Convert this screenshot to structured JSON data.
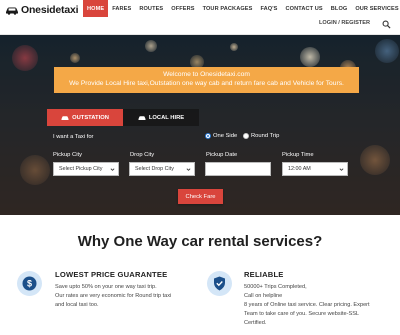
{
  "brand": {
    "name": "Onesidetaxi"
  },
  "nav": {
    "items": [
      "HOME",
      "FARES",
      "ROUTES",
      "OFFERS",
      "TOUR PACKAGES",
      "FAQ'S",
      "CONTACT US",
      "BLOG",
      "OUR SERVICES"
    ],
    "active": "HOME",
    "auth": "LOGIN / REGISTER"
  },
  "hero": {
    "welcome_title": "Welcome to Onesidetaxi.com",
    "welcome_text": "We Provide Local Hire taxi,Outstation one way cab and return fare cab and Vehicle for Tours."
  },
  "booking": {
    "tabs": [
      "OUTSTATION",
      "LOCAL HIRE"
    ],
    "active_tab": "OUTSTATION",
    "want_label": "I want a Taxi for",
    "trip_options": [
      "One Side",
      "Round Trip"
    ],
    "selected_trip": "One Side",
    "pickup_city_label": "Pickup City",
    "pickup_city_value": "Select Pickup City",
    "drop_city_label": "Drop City",
    "drop_city_value": "Select Drop City",
    "pickup_date_label": "Pickup Date",
    "pickup_date_value": "",
    "pickup_time_label": "Pickup Time",
    "pickup_time_value": "12:00 AM",
    "submit_label": "Check Fare"
  },
  "why": {
    "heading": "Why One Way car rental services?",
    "features": [
      {
        "icon": "dollar-icon",
        "title": "LOWEST PRICE GUARANTEE",
        "lines": [
          "Save upto 50% on your one way taxi trip.",
          "Our rates are very economic for Round trip taxi",
          "and local taxi too."
        ]
      },
      {
        "icon": "shield-check-icon",
        "title": "RELIABLE",
        "lines": [
          "50000+ Trips Completed,",
          "Call on helpline",
          "8 years of Online taxi service. Clear pricing. Expert",
          "Team to take care of you. Secure website-SSL",
          "Certified."
        ]
      }
    ]
  },
  "colors": {
    "accent": "#d9453c",
    "welcome": "#f4a847",
    "icon_bg": "#d4e6f7",
    "icon_fg": "#1b4f8a"
  }
}
